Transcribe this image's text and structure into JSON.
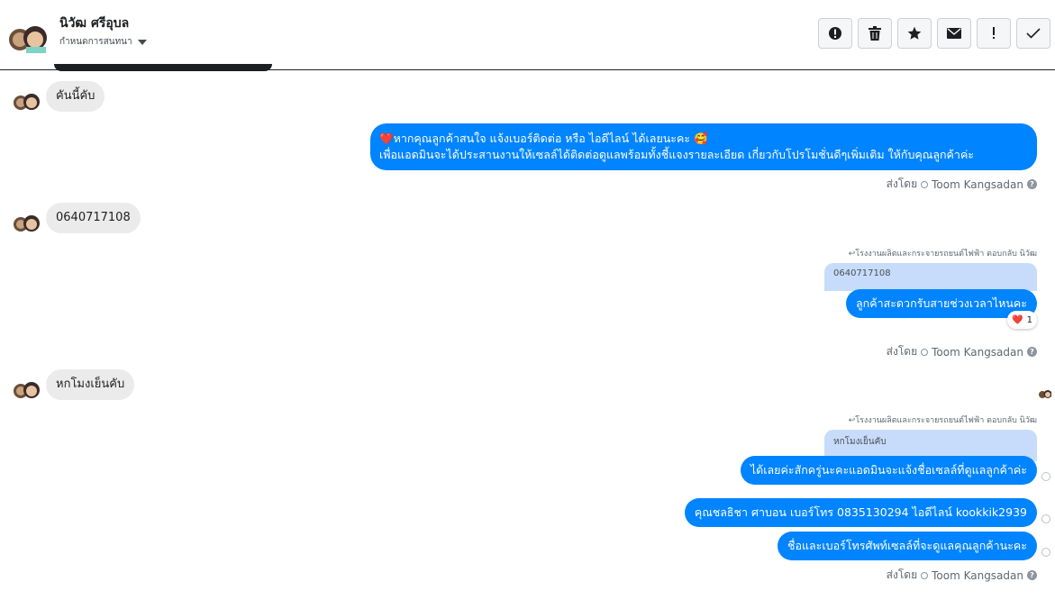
{
  "header": {
    "contact_name": "นิวัฒ ศรีอุบล",
    "conversation_action_label": "กำหนดการสนทนา",
    "toolbar": [
      {
        "name": "mark-spam-button",
        "icon": "alert-circle-icon"
      },
      {
        "name": "delete-button",
        "icon": "trash-icon"
      },
      {
        "name": "star-button",
        "icon": "star-icon"
      },
      {
        "name": "mark-unread-button",
        "icon": "envelope-icon"
      },
      {
        "name": "important-button",
        "icon": "exclamation-icon"
      },
      {
        "name": "mark-done-button",
        "icon": "check-icon"
      }
    ]
  },
  "messages": {
    "m1": "คันนี้คับ",
    "m2_line1": "หากคุณลูกค้าสนใจ แจ้งเบอร์ติดต่อ หรือ ไอดีไลน์ ได้เลยนะคะ 🥰",
    "m2_line2": "เพื่อแอดมินจะได้ประสานงานให้เซลล์ได้ติดต่อดูแลพร้อมทั้งชี้แจงรายละเอียด เกี่ยวกับโปรโมชั่นดีๆเพิ่มเติม ให้กับคุณลูกค้าค่ะ",
    "m2_heart": "❤️",
    "m3": "0640717108",
    "m4_reply_label": "↩โรงงานผลิตและกระจายรถยนต์ไฟฟ้า ตอบกลับ นิวัฒ",
    "m4_quote": "0640717108",
    "m4": "ลูกค้าสะดวกรับสายช่วงเวลาไหนคะ",
    "m4_reaction_emoji": "❤️",
    "m4_reaction_count": "1",
    "m5": "หกโมงเย็นคับ",
    "m6_reply_label": "↩โรงงานผลิตและกระจายรถยนต์ไฟฟ้า ตอบกลับ นิวัฒ",
    "m6_quote": "หกโมงเย็นคับ",
    "m6": "ได้เลยค่ะสักครู่นะคะแอดมินจะแจ้งชื่อเซลล์ที่ดูแลลูกค้าค่ะ",
    "m7": "คุณชลธิชา ศาบอน เบอร์โทร 0835130294  ไอดีไลน์ kookkik2939",
    "m8": "ชื่อและเบอร์โทรศัพท์เซลล์ที่จะดูแลคุณลูกค้านะคะ"
  },
  "sent_by": {
    "prefix": "ส่งโดย",
    "agent": "Toom Kangsadan",
    "help": "?"
  },
  "colors": {
    "outgoing_bubble": "#0084ff",
    "incoming_bubble": "#ebebeb",
    "reply_quote": "#c7dcfb"
  }
}
